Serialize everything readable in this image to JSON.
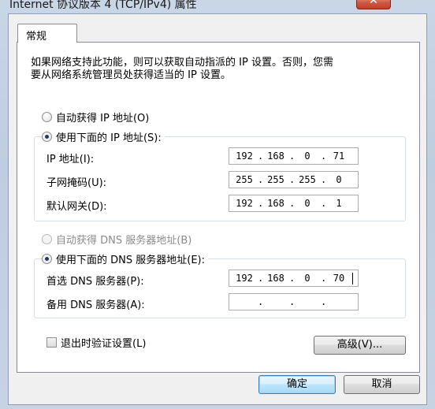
{
  "window": {
    "title": "Internet 协议版本 4 (TCP/IPv4) 属性",
    "close_label": "✕"
  },
  "tab": {
    "label": "常规"
  },
  "intro": "如果网络支持此功能，则可以获取自动指派的 IP 设置。否则，您需\n要从网络系统管理员处获得适当的 IP 设置。",
  "ip": {
    "auto_label": "自动获得 IP 地址(O)",
    "manual_label": "使用下面的 IP 地址(S):",
    "mode": "manual",
    "fields": [
      {
        "label": "IP 地址(I):",
        "octets": [
          "192",
          "168",
          "0",
          "71"
        ]
      },
      {
        "label": "子网掩码(U):",
        "octets": [
          "255",
          "255",
          "255",
          "0"
        ]
      },
      {
        "label": "默认网关(D):",
        "octets": [
          "192",
          "168",
          "0",
          "1"
        ]
      }
    ]
  },
  "dns": {
    "auto_label": "自动获得 DNS 服务器地址(B)",
    "manual_label": "使用下面的 DNS 服务器地址(E):",
    "mode": "manual",
    "fields": [
      {
        "label": "首选 DNS 服务器(P):",
        "octets": [
          "192",
          "168",
          "0",
          "70"
        ]
      },
      {
        "label": "备用 DNS 服务器(A):",
        "octets": [
          "",
          "",
          "",
          ""
        ]
      }
    ]
  },
  "validate_on_exit": {
    "label": "退出时验证设置(L)",
    "checked": false
  },
  "buttons": {
    "advanced": "高级(V)...",
    "ok": "确定",
    "cancel": "取消"
  }
}
